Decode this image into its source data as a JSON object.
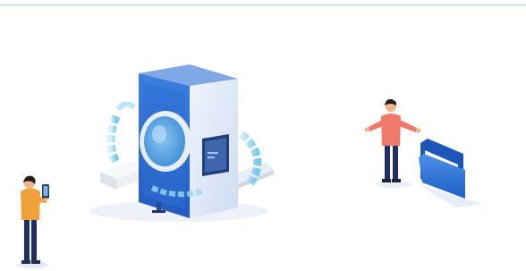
{
  "colors": {
    "rule": "#9fd3ec",
    "scanner_blue": "#2f6fd6",
    "scanner_light": "#dfe9f7",
    "lens": "#5aa7e8",
    "folder_blue": "#2a74d9",
    "skin": "#f1b48e",
    "jacket_orange": "#f0a23a",
    "shirt_coral": "#f07a6a",
    "pants_navy": "#1f2f63"
  },
  "icons": {
    "left_person": "person-with-phone-icon",
    "scanner": "document-scanner-icon",
    "right_person": "presenter-person-icon",
    "folder": "folder-icon"
  }
}
